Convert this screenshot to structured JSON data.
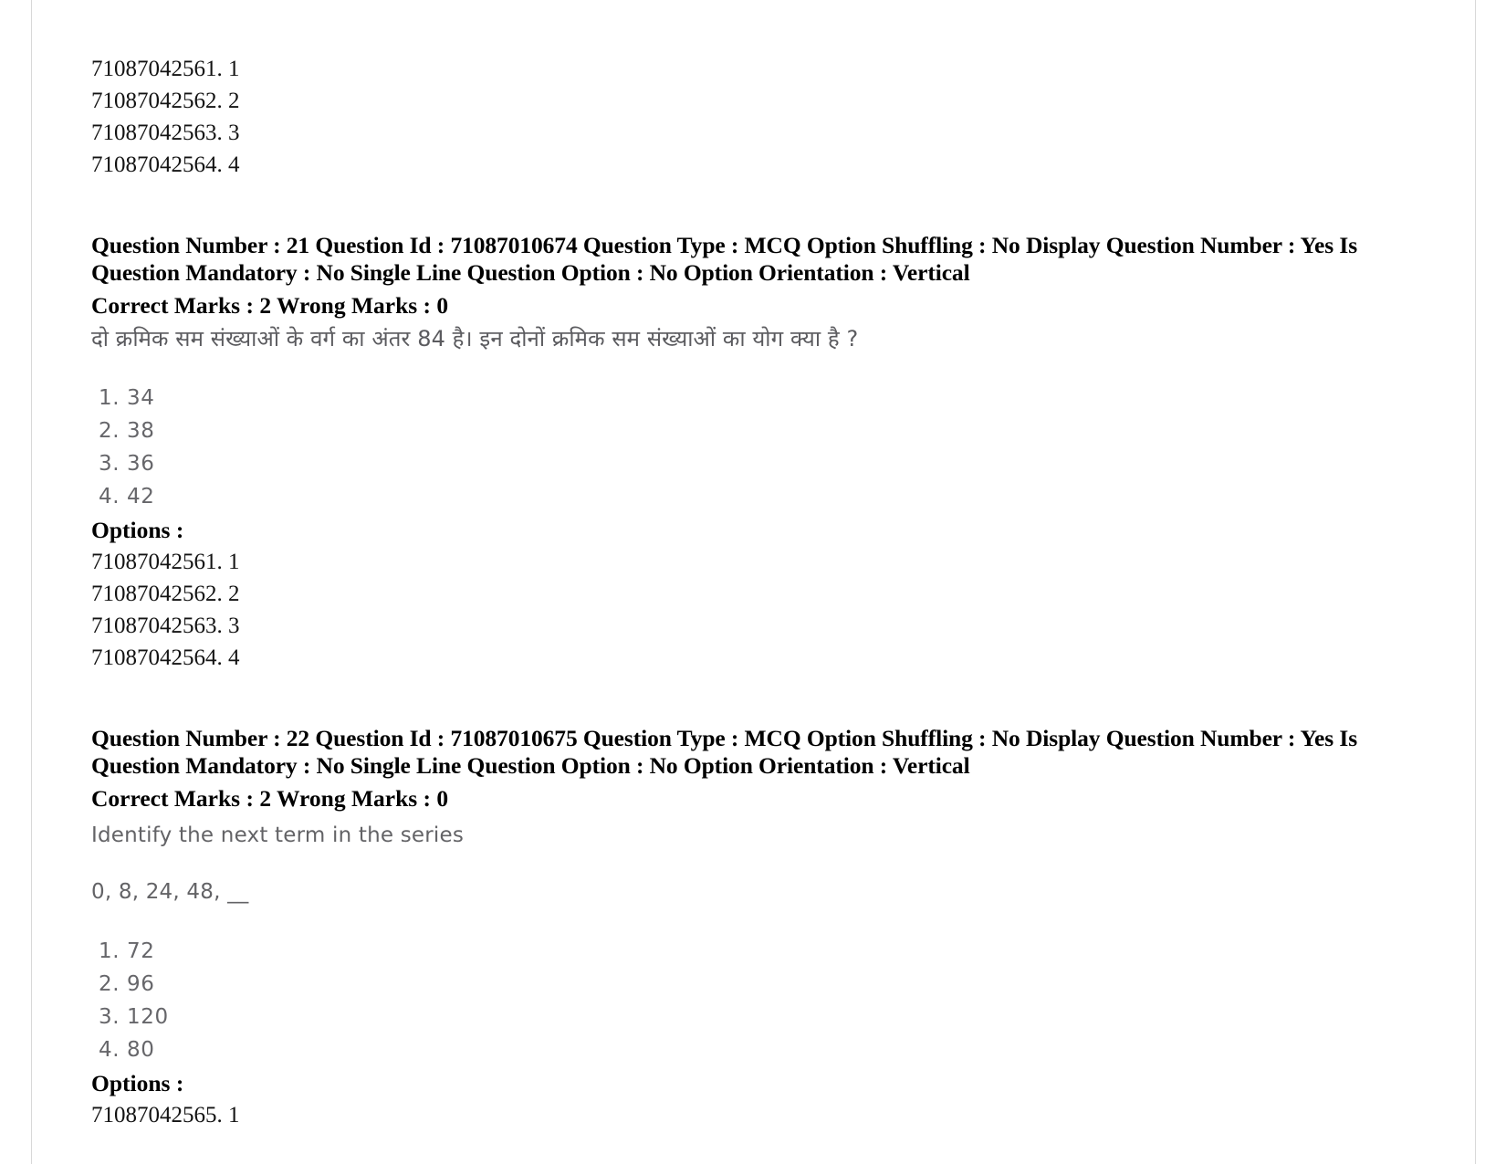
{
  "page": {
    "top_option_ids": [
      "71087042561. 1",
      "71087042562. 2",
      "71087042563. 3",
      "71087042564. 4"
    ]
  },
  "questions": [
    {
      "meta_line1": "Question Number : 21 Question Id : 71087010674 Question Type : MCQ Option Shuffling : No Display Question Number : Yes Is",
      "meta_line2": "Question Mandatory : No Single Line Question Option : No Option Orientation : Vertical",
      "marks_line": "Correct Marks : 2 Wrong Marks : 0",
      "question_text": "दो क्रमिक सम संख्याओं के वर्ग का अंतर 84 है। इन दोनों क्रमिक सम संख्याओं का योग क्या है ?",
      "question_lang": "hindi",
      "choices": [
        "1. 34",
        "2. 38",
        "3. 36",
        "4. 42"
      ],
      "options_label": "Options :",
      "option_ids": [
        "71087042561. 1",
        "71087042562. 2",
        "71087042563. 3",
        "71087042564. 4"
      ]
    },
    {
      "meta_line1": "Question Number : 22 Question Id : 71087010675 Question Type : MCQ Option Shuffling : No Display Question Number : Yes Is",
      "meta_line2": "Question Mandatory : No Single Line Question Option : No Option Orientation : Vertical",
      "marks_line": "Correct Marks : 2 Wrong Marks : 0",
      "question_text": "Identify the next term in the series",
      "question_series": "0, 8, 24, 48, __",
      "question_lang": "english",
      "choices": [
        "1. 72",
        "2. 96",
        "3. 120",
        "4. 80"
      ],
      "options_label": "Options :",
      "option_ids": [
        "71087042565. 1"
      ]
    }
  ]
}
